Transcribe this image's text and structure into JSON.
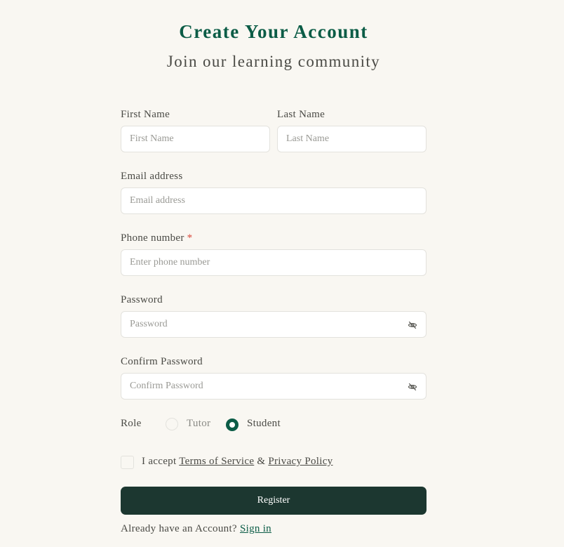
{
  "header": {
    "title": "Create Your Account",
    "subtitle": "Join our learning community"
  },
  "form": {
    "first_name": {
      "label": "First Name",
      "placeholder": "First Name",
      "value": ""
    },
    "last_name": {
      "label": "Last Name",
      "placeholder": "Last Name",
      "value": ""
    },
    "email": {
      "label": "Email address",
      "placeholder": "Email address",
      "value": ""
    },
    "phone": {
      "label": "Phone number",
      "required_mark": "*",
      "placeholder": "Enter phone number",
      "value": ""
    },
    "password": {
      "label": "Password",
      "placeholder": "Password",
      "value": "",
      "toggle_icon": "eye-off-icon"
    },
    "confirm_password": {
      "label": "Confirm Password",
      "placeholder": "Confirm Password",
      "value": "",
      "toggle_icon": "eye-off-icon"
    },
    "role": {
      "label": "Role",
      "options": [
        {
          "label": "Tutor",
          "selected": false
        },
        {
          "label": "Student",
          "selected": true
        }
      ]
    },
    "terms": {
      "checked": false,
      "prefix": "I accept",
      "terms_link": "Terms of Service",
      "separator": "&",
      "privacy_link": "Privacy Policy"
    },
    "submit_label": "Register",
    "signin_prompt": "Already have an Account?",
    "signin_link": "Sign in"
  },
  "colors": {
    "background": "#f9f7f2",
    "accent": "#0b5c46",
    "button": "#1c3730",
    "required": "#d9493b"
  }
}
